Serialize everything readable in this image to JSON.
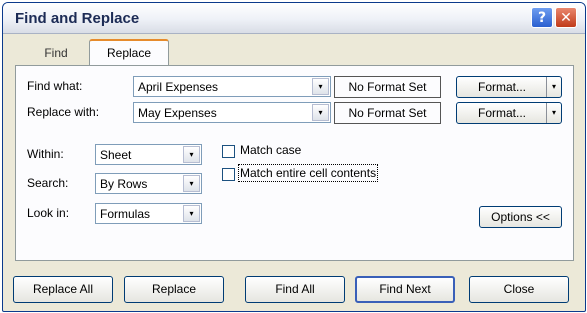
{
  "dialog": {
    "title": "Find and Replace",
    "help_glyph": "?",
    "close_glyph": "✕"
  },
  "tabs": [
    {
      "label": "Find",
      "selected": false
    },
    {
      "label": "Replace",
      "selected": true
    }
  ],
  "find": {
    "label": "Find what:",
    "value": "April Expenses",
    "format_status": "No Format Set",
    "format_button": "Format...",
    "dropdown_glyph": "▾"
  },
  "replace": {
    "label": "Replace with:",
    "value": "May Expenses",
    "format_status": "No Format Set",
    "format_button": "Format...",
    "dropdown_glyph": "▾"
  },
  "options": {
    "within": {
      "label": "Within:",
      "value": "Sheet"
    },
    "search": {
      "label": "Search:",
      "value": "By Rows"
    },
    "lookin": {
      "label": "Look in:",
      "value": "Formulas"
    },
    "match_case": {
      "label": "Match case",
      "checked": false
    },
    "match_entire": {
      "label": "Match entire cell contents",
      "checked": false
    },
    "options_button": "Options <<"
  },
  "buttons": {
    "replace_all": "Replace All",
    "replace": "Replace",
    "find_all": "Find All",
    "find_next": "Find Next",
    "close": "Close"
  },
  "colors": {
    "title_text": "#1c2b55",
    "dialog_bg": "#ece9d8",
    "accent_tab": "#e68b2c"
  }
}
